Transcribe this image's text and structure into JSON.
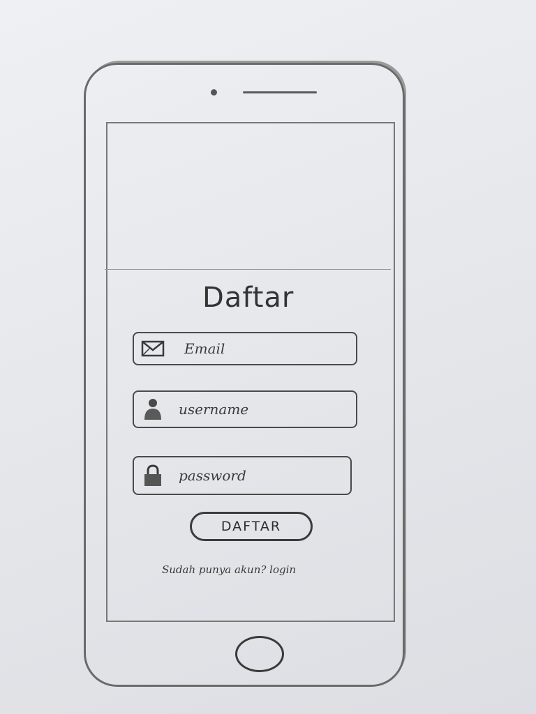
{
  "form": {
    "title": "Daftar",
    "fields": [
      {
        "icon": "envelope-icon",
        "placeholder": "Email"
      },
      {
        "icon": "user-icon",
        "placeholder": "username"
      },
      {
        "icon": "lock-icon",
        "placeholder": "password"
      }
    ],
    "submit_label": "DAFTAR",
    "login_prompt": "Sudah punya akun? login"
  }
}
